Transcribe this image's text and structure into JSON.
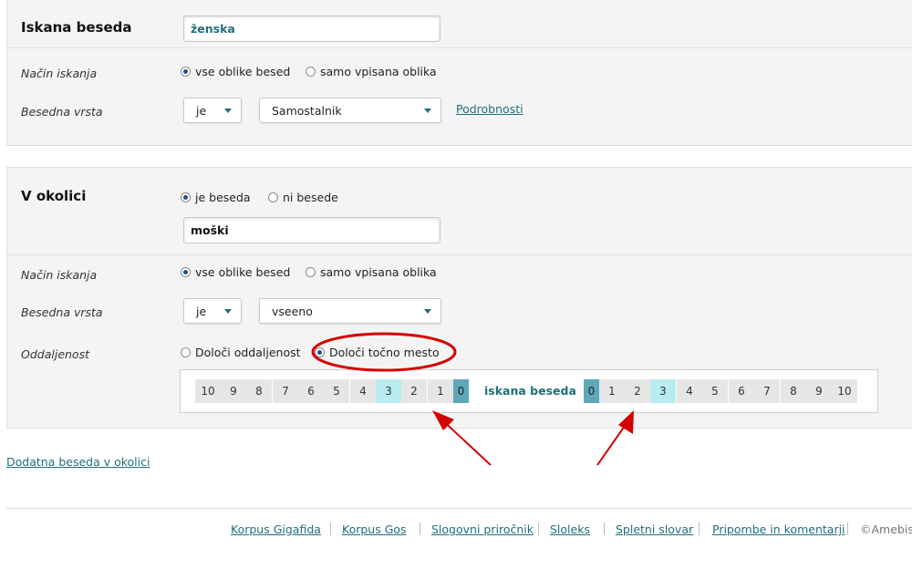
{
  "search": {
    "title": "Iskana beseda",
    "word_value": "ženska",
    "mode_label": "Način iskanja",
    "mode_option_all": "vse oblike besed",
    "mode_option_exact": "samo vpisana oblika",
    "mode_selected": "vse oblike besed",
    "pos_label": "Besedna vrsta",
    "pos_operator": "je",
    "pos_value": "Samostalnik",
    "details_link": "Podrobnosti"
  },
  "context": {
    "title": "V okolici",
    "option_is_word": "je beseda",
    "option_not_word": "ni besede",
    "selected": "je beseda",
    "word_value": "moški",
    "mode_label": "Način iskanja",
    "mode_option_all": "vse oblike besed",
    "mode_option_exact": "samo vpisana oblika",
    "pos_label": "Besedna vrsta",
    "pos_operator": "je",
    "pos_value": "vseeno",
    "distance_label": "Oddaljenost",
    "distance_option_range": "Določi oddaljenost",
    "distance_option_exact": "Določi točno mesto",
    "distance_selected": "Določi točno mesto",
    "center_label": "iskana beseda",
    "left_positions": [
      "10",
      "9",
      "8",
      "7",
      "6",
      "5",
      "4",
      "3",
      "2",
      "1",
      "0"
    ],
    "right_positions": [
      "0",
      "1",
      "2",
      "3",
      "4",
      "5",
      "6",
      "7",
      "8",
      "9",
      "10"
    ],
    "selected_left_position": "3",
    "selected_right_position": "3"
  },
  "add_context_link": "Dodatna beseda v okolici",
  "footer": {
    "links": [
      "Korpus Gigafida",
      "Korpus Gos",
      "Slogovni priročnik",
      "Sloleks",
      "Spletni slovar",
      "Pripombe in komentarji"
    ],
    "copyright": "©Amebis,"
  },
  "colors": {
    "accent": "#1f6f7a",
    "selected_cell": "#b9ecef",
    "zero_cell": "#5fa8bc",
    "annotation_red": "#d40000"
  }
}
